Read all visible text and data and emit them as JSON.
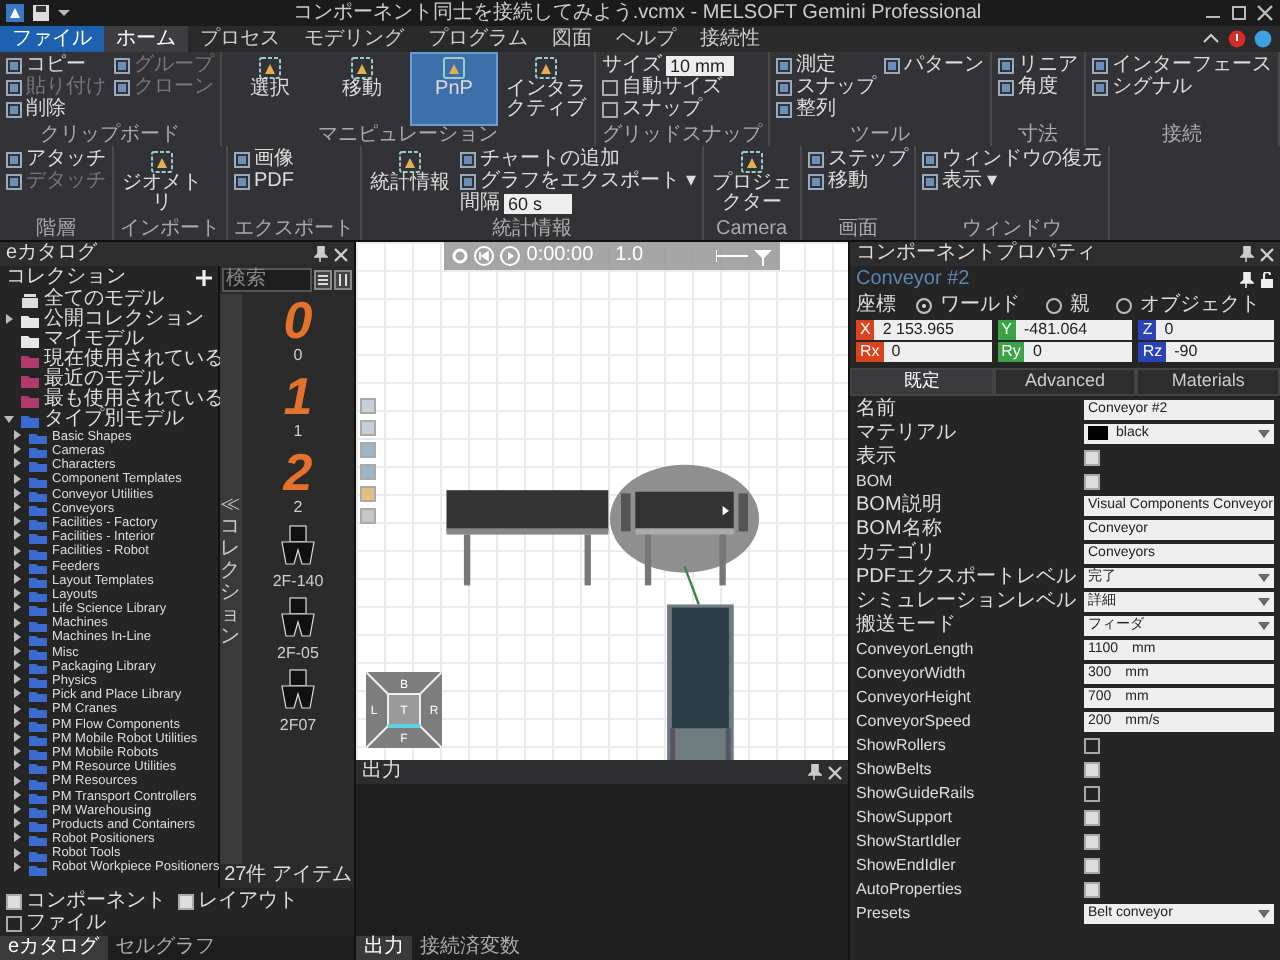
{
  "window": {
    "title": "コンポーネント同士を接続してみよう.vcmx - MELSOFT Gemini Professional"
  },
  "ribbon": {
    "tabs": [
      {
        "label": "ファイル",
        "kind": "file",
        "selected": false
      },
      {
        "label": "ホーム",
        "kind": "tab",
        "selected": true
      },
      {
        "label": "プロセス",
        "kind": "tab",
        "selected": false
      },
      {
        "label": "モデリング",
        "kind": "tab",
        "selected": false
      },
      {
        "label": "プログラム",
        "kind": "tab",
        "selected": false
      },
      {
        "label": "図面",
        "kind": "tab",
        "selected": false
      },
      {
        "label": "ヘルプ",
        "kind": "tab",
        "selected": false
      },
      {
        "label": "接続性",
        "kind": "tab",
        "selected": false
      }
    ],
    "groups": [
      {
        "label": "クリップボード",
        "items": [
          {
            "kind": "small",
            "label": "コピー",
            "disabled": false
          },
          {
            "kind": "small",
            "label": "貼り付け",
            "disabled": true
          },
          {
            "kind": "small",
            "label": "削除",
            "disabled": false
          },
          {
            "kind": "small",
            "label": "グループ",
            "disabled": true
          },
          {
            "kind": "small",
            "label": "クローン",
            "disabled": true
          }
        ]
      },
      {
        "label": "マニピュレーション",
        "items": [
          {
            "kind": "large",
            "label": "選択",
            "selected": false
          },
          {
            "kind": "large",
            "label": "移動",
            "selected": false
          },
          {
            "kind": "large",
            "label": "PnP",
            "selected": true
          },
          {
            "kind": "large",
            "label": "インタラクティブ",
            "selected": false
          }
        ]
      },
      {
        "label": "グリッドスナップ",
        "items": [
          {
            "kind": "field",
            "label": "サイズ",
            "value": "10",
            "unit": "mm"
          },
          {
            "kind": "check",
            "label": "自動サイズ",
            "checked": false
          },
          {
            "kind": "check",
            "label": "スナップ",
            "checked": false
          }
        ]
      },
      {
        "label": "ツール",
        "items": [
          {
            "kind": "small",
            "label": "測定",
            "disabled": false
          },
          {
            "kind": "small",
            "label": "スナップ",
            "disabled": false
          },
          {
            "kind": "small",
            "label": "整列",
            "disabled": false
          },
          {
            "kind": "small",
            "label": "パターン",
            "disabled": false
          }
        ]
      },
      {
        "label": "寸法",
        "items": [
          {
            "kind": "small",
            "label": "リニア",
            "disabled": false
          },
          {
            "kind": "small",
            "label": "角度",
            "disabled": false
          }
        ]
      },
      {
        "label": "接続",
        "items": [
          {
            "kind": "small",
            "label": "インターフェース",
            "disabled": false
          },
          {
            "kind": "small",
            "label": "シグナル",
            "disabled": false
          }
        ]
      },
      {
        "label": "階層",
        "items": [
          {
            "kind": "small",
            "label": "アタッチ",
            "disabled": false
          },
          {
            "kind": "small",
            "label": "デタッチ",
            "disabled": true
          }
        ]
      },
      {
        "label": "インポート",
        "items": [
          {
            "kind": "large",
            "label": "ジオメトリ"
          }
        ]
      },
      {
        "label": "エクスポート",
        "items": [
          {
            "kind": "small",
            "label": "画像",
            "disabled": false
          },
          {
            "kind": "small",
            "label": "PDF",
            "disabled": false
          }
        ]
      },
      {
        "label": "統計情報",
        "items": [
          {
            "kind": "large",
            "label": "統計情報"
          },
          {
            "kind": "small",
            "label": "チャートの追加",
            "disabled": false
          },
          {
            "kind": "small",
            "label": "グラフをエクスポート ▾",
            "disabled": false
          },
          {
            "kind": "field",
            "label": "間隔",
            "value": "60",
            "unit": "s"
          }
        ]
      },
      {
        "label": "Camera",
        "items": [
          {
            "kind": "large",
            "label": "プロジェクター"
          }
        ]
      },
      {
        "label": "画面",
        "items": [
          {
            "kind": "small",
            "label": "ステップ",
            "disabled": false
          },
          {
            "kind": "small",
            "label": "移動",
            "disabled": false
          }
        ]
      },
      {
        "label": "ウィンドウ",
        "items": [
          {
            "kind": "small",
            "label": "ウィンドウの復元",
            "disabled": false
          },
          {
            "kind": "small",
            "label": "表示 ▾",
            "disabled": false
          }
        ]
      }
    ]
  },
  "catalog": {
    "title": "eカタログ",
    "collections_label": "コレクション",
    "tree": [
      {
        "label": "全てのモデル",
        "kind": "all"
      },
      {
        "label": "公開コレクション",
        "kind": "folder",
        "expanded": false
      },
      {
        "label": "マイモデル",
        "kind": "folder"
      },
      {
        "label": "現在使用されている",
        "kind": "recent"
      },
      {
        "label": "最近のモデル",
        "kind": "recent"
      },
      {
        "label": "最も使用されている",
        "kind": "recent"
      },
      {
        "label": "タイプ別モデル",
        "kind": "type",
        "expanded": true,
        "children": [
          {
            "label": "Basic Shapes",
            "kind": "type",
            "expanded": false
          },
          {
            "label": "Cameras",
            "kind": "type",
            "expanded": false
          },
          {
            "label": "Characters",
            "kind": "type",
            "expanded": false
          },
          {
            "label": "Component Templates",
            "kind": "type",
            "expanded": false
          },
          {
            "label": "Conveyor Utilities",
            "kind": "type",
            "expanded": false
          },
          {
            "label": "Conveyors",
            "kind": "type",
            "expanded": false
          },
          {
            "label": "Facilities - Factory",
            "kind": "type",
            "expanded": false
          },
          {
            "label": "Facilities - Interior",
            "kind": "type",
            "expanded": false
          },
          {
            "label": "Facilities - Robot",
            "kind": "type",
            "expanded": false
          },
          {
            "label": "Feeders",
            "kind": "type",
            "expanded": false
          },
          {
            "label": "Layout Templates",
            "kind": "type",
            "expanded": false
          },
          {
            "label": "Layouts",
            "kind": "type",
            "expanded": false
          },
          {
            "label": "Life Science Library",
            "kind": "type",
            "expanded": false
          },
          {
            "label": "Machines",
            "kind": "type",
            "expanded": false
          },
          {
            "label": "Machines In-Line",
            "kind": "type",
            "expanded": false
          },
          {
            "label": "Misc",
            "kind": "type",
            "expanded": false
          },
          {
            "label": "Packaging Library",
            "kind": "type",
            "expanded": false
          },
          {
            "label": "Physics",
            "kind": "type",
            "expanded": false
          },
          {
            "label": "Pick and Place Library",
            "kind": "type",
            "expanded": false
          },
          {
            "label": "PM Cranes",
            "kind": "type",
            "expanded": false
          },
          {
            "label": "PM Flow Components",
            "kind": "type",
            "expanded": false
          },
          {
            "label": "PM Mobile Robot Utilities",
            "kind": "type",
            "expanded": false
          },
          {
            "label": "PM Mobile Robots",
            "kind": "type",
            "expanded": false
          },
          {
            "label": "PM Resource Utilities",
            "kind": "type",
            "expanded": false
          },
          {
            "label": "PM Resources",
            "kind": "type",
            "expanded": false
          },
          {
            "label": "PM Transport Controllers",
            "kind": "type",
            "expanded": false
          },
          {
            "label": "PM Warehousing",
            "kind": "type",
            "expanded": false
          },
          {
            "label": "Products and Containers",
            "kind": "type",
            "expanded": false
          },
          {
            "label": "Robot Positioners",
            "kind": "type",
            "expanded": false
          },
          {
            "label": "Robot Tools",
            "kind": "type",
            "expanded": false
          },
          {
            "label": "Robot Workpiece Positioners",
            "kind": "type",
            "expanded": false
          }
        ]
      }
    ],
    "search": {
      "placeholder": "検索"
    },
    "side_tab": "≪ コレクション",
    "thumbnails": [
      {
        "kind": "digit",
        "glyph": "0",
        "label": "0"
      },
      {
        "kind": "digit",
        "glyph": "1",
        "label": "1"
      },
      {
        "kind": "digit",
        "glyph": "2",
        "label": "2"
      },
      {
        "kind": "gripper",
        "label": "2F-140"
      },
      {
        "kind": "gripper",
        "label": "2F-05"
      },
      {
        "kind": "gripper",
        "label": "2F07"
      }
    ],
    "item_count": "27件 アイテム",
    "filters": [
      {
        "label": "コンポーネント",
        "checked": true
      },
      {
        "label": "レイアウト",
        "checked": true
      },
      {
        "label": "ファイル",
        "checked": false
      }
    ],
    "tabs": [
      {
        "label": "eカタログ",
        "selected": true
      },
      {
        "label": "セルグラフ",
        "selected": false
      }
    ]
  },
  "viewport": {
    "timer": "0:00:00",
    "speed": "1.0",
    "nav_cube": {
      "top": "B",
      "left": "L",
      "center": "T",
      "right": "R",
      "bottom": "F"
    }
  },
  "output": {
    "title": "出力",
    "tabs": [
      {
        "label": "出力",
        "selected": true
      },
      {
        "label": "接続済変数",
        "selected": false
      }
    ]
  },
  "properties": {
    "title": "コンポーネントプロパティ",
    "component": "Conveyor #2",
    "coord_label": "座標",
    "coord_modes": [
      {
        "label": "ワールド",
        "selected": true
      },
      {
        "label": "親",
        "selected": false
      },
      {
        "label": "オブジェクト",
        "selected": false
      }
    ],
    "coords": [
      {
        "label": "X",
        "value": "2 153.965",
        "color": "#d9441e"
      },
      {
        "label": "Y",
        "value": "-481.064",
        "color": "#3aa346"
      },
      {
        "label": "Z",
        "value": "0",
        "color": "#2a44b8"
      },
      {
        "label": "Rx",
        "value": "0",
        "color": "#d9441e"
      },
      {
        "label": "Ry",
        "value": "0",
        "color": "#3aa346"
      },
      {
        "label": "Rz",
        "value": "-90",
        "color": "#2a44b8"
      }
    ],
    "tabs": [
      {
        "label": "既定",
        "selected": true
      },
      {
        "label": "Advanced",
        "selected": false
      },
      {
        "label": "Materials",
        "selected": false
      }
    ],
    "rows": [
      {
        "label": "名前",
        "kind": "text",
        "value": "Conveyor #2"
      },
      {
        "label": "マテリアル",
        "kind": "material",
        "value": "black",
        "color": "#000000"
      },
      {
        "label": "表示",
        "kind": "check",
        "checked": true
      },
      {
        "label": "BOM",
        "kind": "check",
        "checked": true
      },
      {
        "label": "BOM説明",
        "kind": "text",
        "value": "Visual Components Conveyor"
      },
      {
        "label": "BOM名称",
        "kind": "text",
        "value": "Conveyor"
      },
      {
        "label": "カテゴリ",
        "kind": "text",
        "value": "Conveyors"
      },
      {
        "label": "PDFエクスポートレベル",
        "kind": "select",
        "value": "完了"
      },
      {
        "label": "シミュレーションレベル",
        "kind": "select",
        "value": "詳細"
      },
      {
        "label": "搬送モード",
        "kind": "select",
        "value": "フィーダ"
      },
      {
        "label": "ConveyorLength",
        "kind": "number",
        "value": "1100",
        "unit": "mm"
      },
      {
        "label": "ConveyorWidth",
        "kind": "number",
        "value": "300",
        "unit": "mm"
      },
      {
        "label": "ConveyorHeight",
        "kind": "number",
        "value": "700",
        "unit": "mm"
      },
      {
        "label": "ConveyorSpeed",
        "kind": "number",
        "value": "200",
        "unit": "mm/s"
      },
      {
        "label": "ShowRollers",
        "kind": "check",
        "checked": false
      },
      {
        "label": "ShowBelts",
        "kind": "check",
        "checked": true
      },
      {
        "label": "ShowGuideRails",
        "kind": "check",
        "checked": false
      },
      {
        "label": "ShowSupport",
        "kind": "check",
        "checked": true
      },
      {
        "label": "ShowStartIdler",
        "kind": "check",
        "checked": true
      },
      {
        "label": "ShowEndIdler",
        "kind": "check",
        "checked": true
      },
      {
        "label": "AutoProperties",
        "kind": "check",
        "checked": true
      },
      {
        "label": "Presets",
        "kind": "select",
        "value": "Belt conveyor"
      }
    ]
  }
}
